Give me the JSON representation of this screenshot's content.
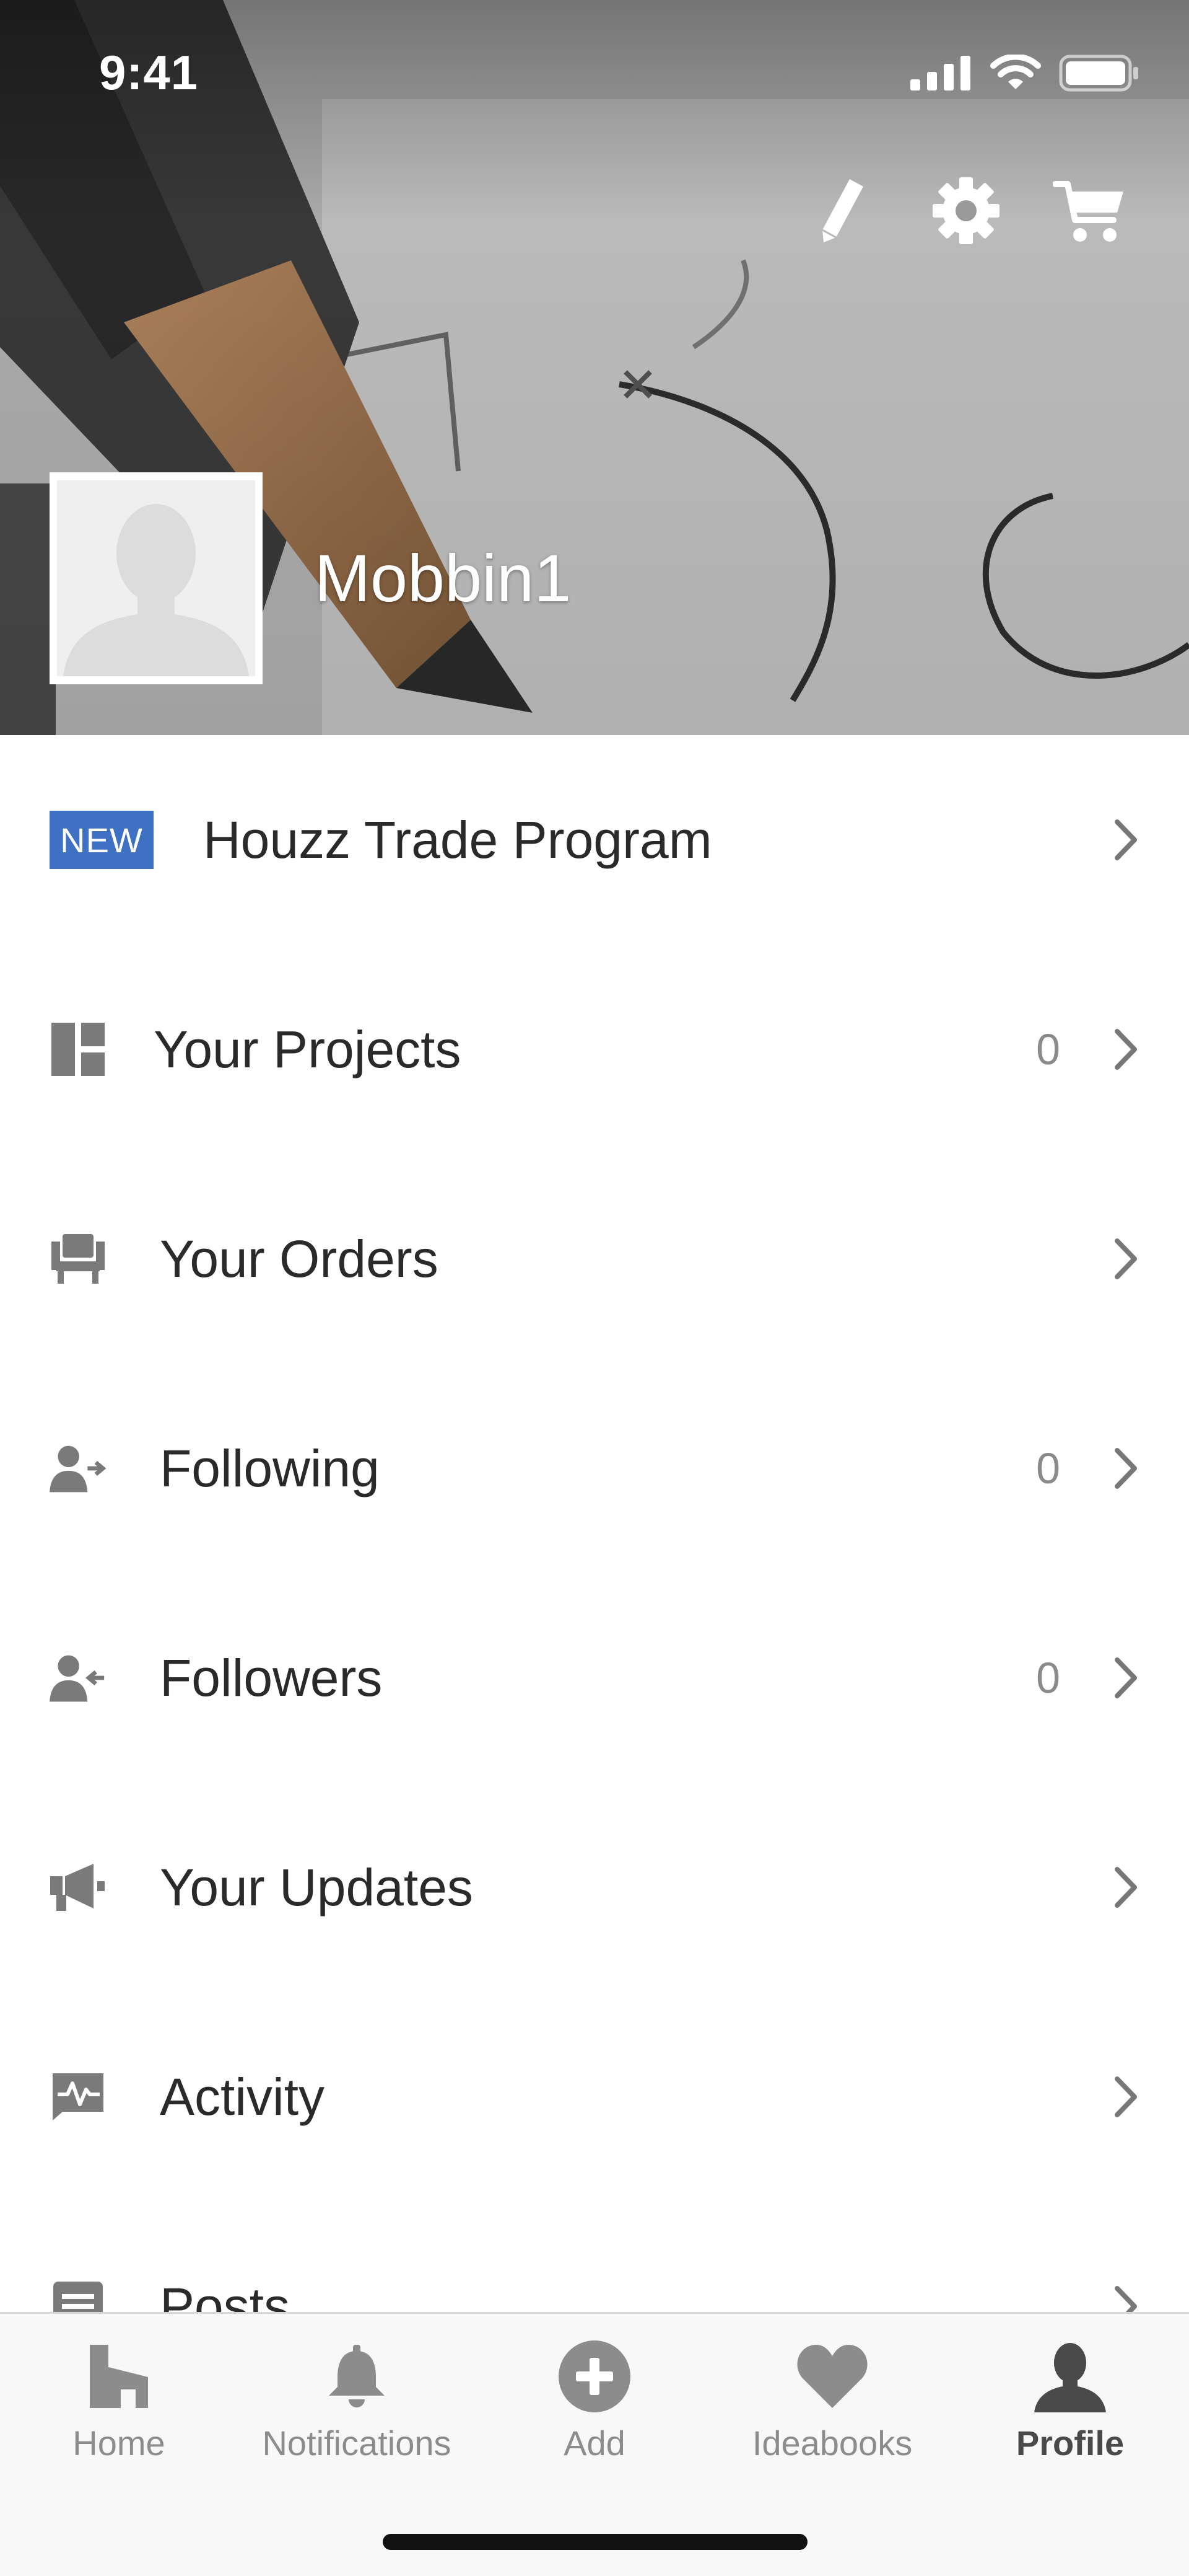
{
  "status_bar": {
    "time": "9:41"
  },
  "header": {
    "username": "Mobbin1",
    "actions": [
      {
        "icon": "pencil-icon"
      },
      {
        "icon": "gear-icon"
      },
      {
        "icon": "cart-icon"
      }
    ]
  },
  "menu": {
    "trade": {
      "badge": "NEW",
      "label": "Houzz Trade Program"
    },
    "projects": {
      "label": "Your Projects",
      "count": "0"
    },
    "orders": {
      "label": "Your Orders"
    },
    "following": {
      "label": "Following",
      "count": "0"
    },
    "followers": {
      "label": "Followers",
      "count": "0"
    },
    "updates": {
      "label": "Your Updates"
    },
    "activity": {
      "label": "Activity"
    },
    "posts": {
      "label": "Posts"
    }
  },
  "tabbar": {
    "tabs": [
      {
        "label": "Home",
        "icon": "home-icon"
      },
      {
        "label": "Notifications",
        "icon": "bell-icon"
      },
      {
        "label": "Add",
        "icon": "plus-circle-icon"
      },
      {
        "label": "Ideabooks",
        "icon": "heart-icon"
      },
      {
        "label": "Profile",
        "icon": "person-icon",
        "active": true
      }
    ]
  },
  "colors": {
    "badge_blue": "#3e70c4",
    "icon_gray": "#7a7a7a",
    "tab_active": "#4a4a4a"
  }
}
